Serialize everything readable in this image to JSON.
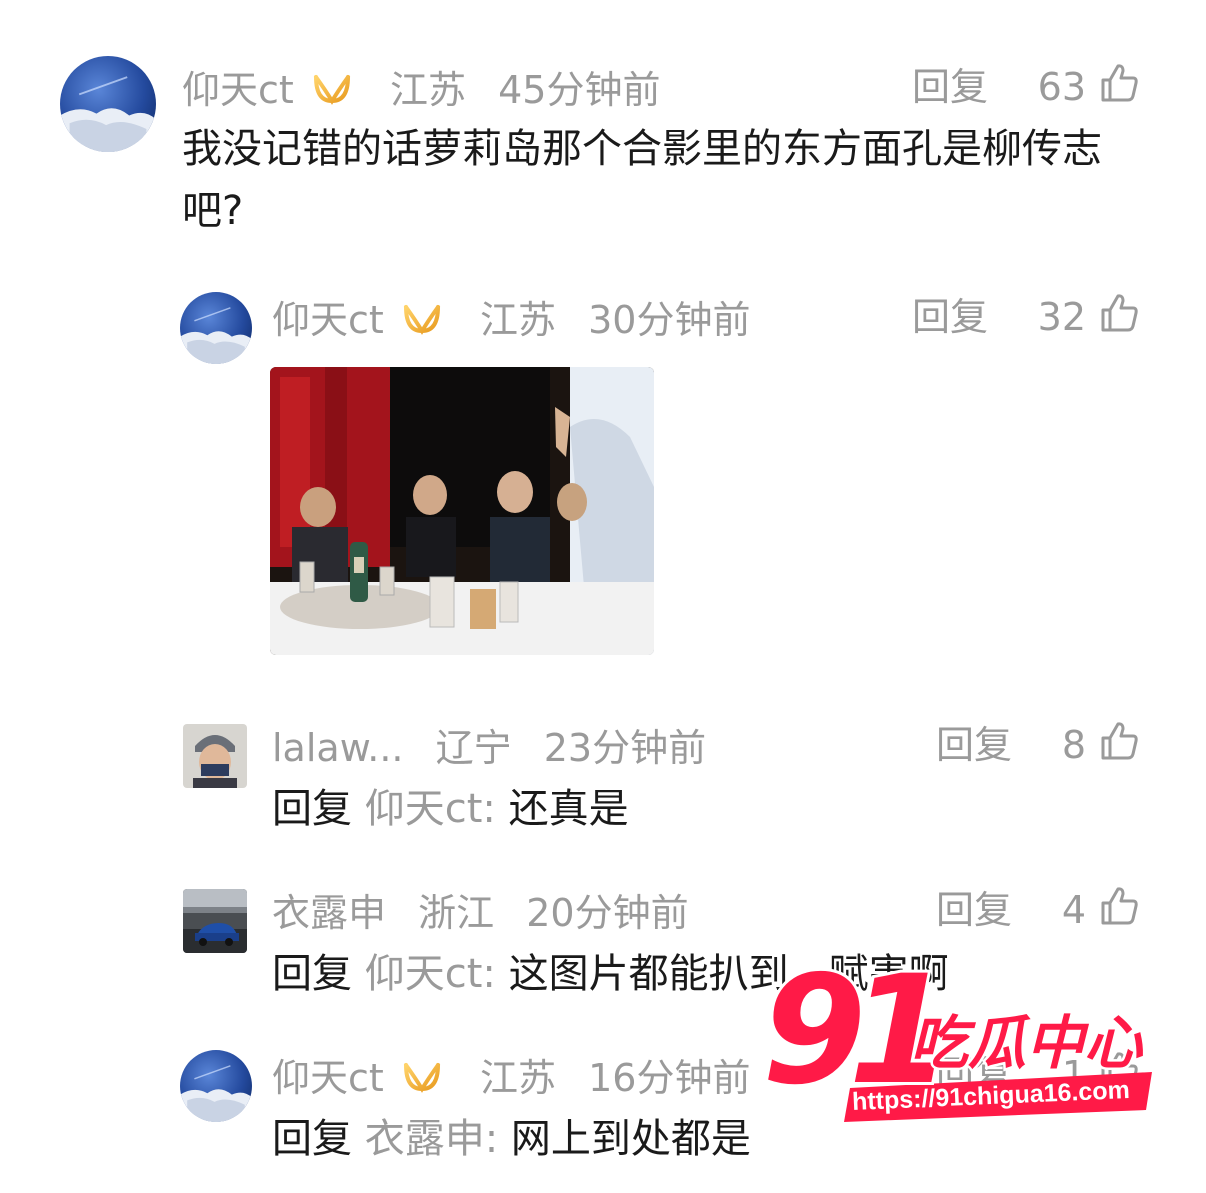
{
  "comments": [
    {
      "user": "仰天ct",
      "vip": true,
      "location": "江苏",
      "time": "45分钟前",
      "reply_label": "回复",
      "likes": "63",
      "text": "我没记错的话萝莉岛那个合影里的东方面孔是柳传志吧?"
    },
    {
      "user": "仰天ct",
      "vip": true,
      "location": "江苏",
      "time": "30分钟前",
      "reply_label": "回复",
      "likes": "32",
      "image": "dinner-table-photo"
    },
    {
      "user": "lalaw...",
      "vip": false,
      "location": "辽宁",
      "time": "23分钟前",
      "reply_label": "回复",
      "likes": "8",
      "reply_prefix": "回复",
      "reply_target": "仰天ct:",
      "text": "还真是"
    },
    {
      "user": "衣露申",
      "vip": false,
      "location": "浙江",
      "time": "20分钟前",
      "reply_label": "回复",
      "likes": "4",
      "reply_prefix": "回复",
      "reply_target": "仰天ct:",
      "text": "这图片都能扒到，赋害啊"
    },
    {
      "user": "仰天ct",
      "vip": true,
      "location": "江苏",
      "time": "16分钟前",
      "reply_label": "回复",
      "likes": "1",
      "reply_prefix": "回复",
      "reply_target": "衣露申:",
      "text": "网上到处都是"
    }
  ],
  "watermark": {
    "number": "91",
    "title": "吃瓜中心",
    "url": "https://91chigua16.com"
  },
  "colors": {
    "meta_gray": "#9a9a9a",
    "text": "#1a1a1a",
    "vip_gold": "#f0b030",
    "watermark_red": "#ff1a47"
  }
}
